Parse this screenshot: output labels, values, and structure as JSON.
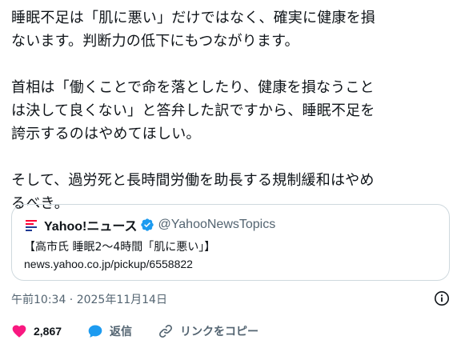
{
  "tweet": {
    "paragraphs": [
      "睡眠不足は「肌に悪い」だけではなく、確実に健康を損\nないます。判断力の低下にもつながります。",
      "首相は「働くことで命を落としたり、健康を損なうこと\nは決して良くない」と答弁した訳ですから、睡眠不足を\n誇示するのはやめてほしい。",
      "そして、過労死と長時間労働を助長する規制緩和はやめ\nるべき。"
    ]
  },
  "quote_card": {
    "source_name": "Yahoo!ニュース",
    "handle": "@YahooNewsTopics",
    "title": "【高市氏 睡眠2～4時間「肌に悪い」】",
    "url": "news.yahoo.co.jp/pickup/6558822"
  },
  "meta": {
    "timestamp": "午前10:34 · 2025年11月14日"
  },
  "actions": {
    "like_count": "2,867",
    "reply_label": "返信",
    "copy_link_label": "リンクをコピー"
  },
  "colors": {
    "like": "#f91880",
    "reply": "#1d9bf0",
    "verified": "#1d9bf0",
    "secondary_text": "#536471",
    "border": "#cfd9de"
  },
  "icons": {
    "like": "heart-icon",
    "reply": "speech-bubble-icon",
    "copy_link": "link-icon",
    "info": "info-icon",
    "verified": "verified-badge-icon",
    "source_logo": "yahoo-news-logo-icon"
  }
}
